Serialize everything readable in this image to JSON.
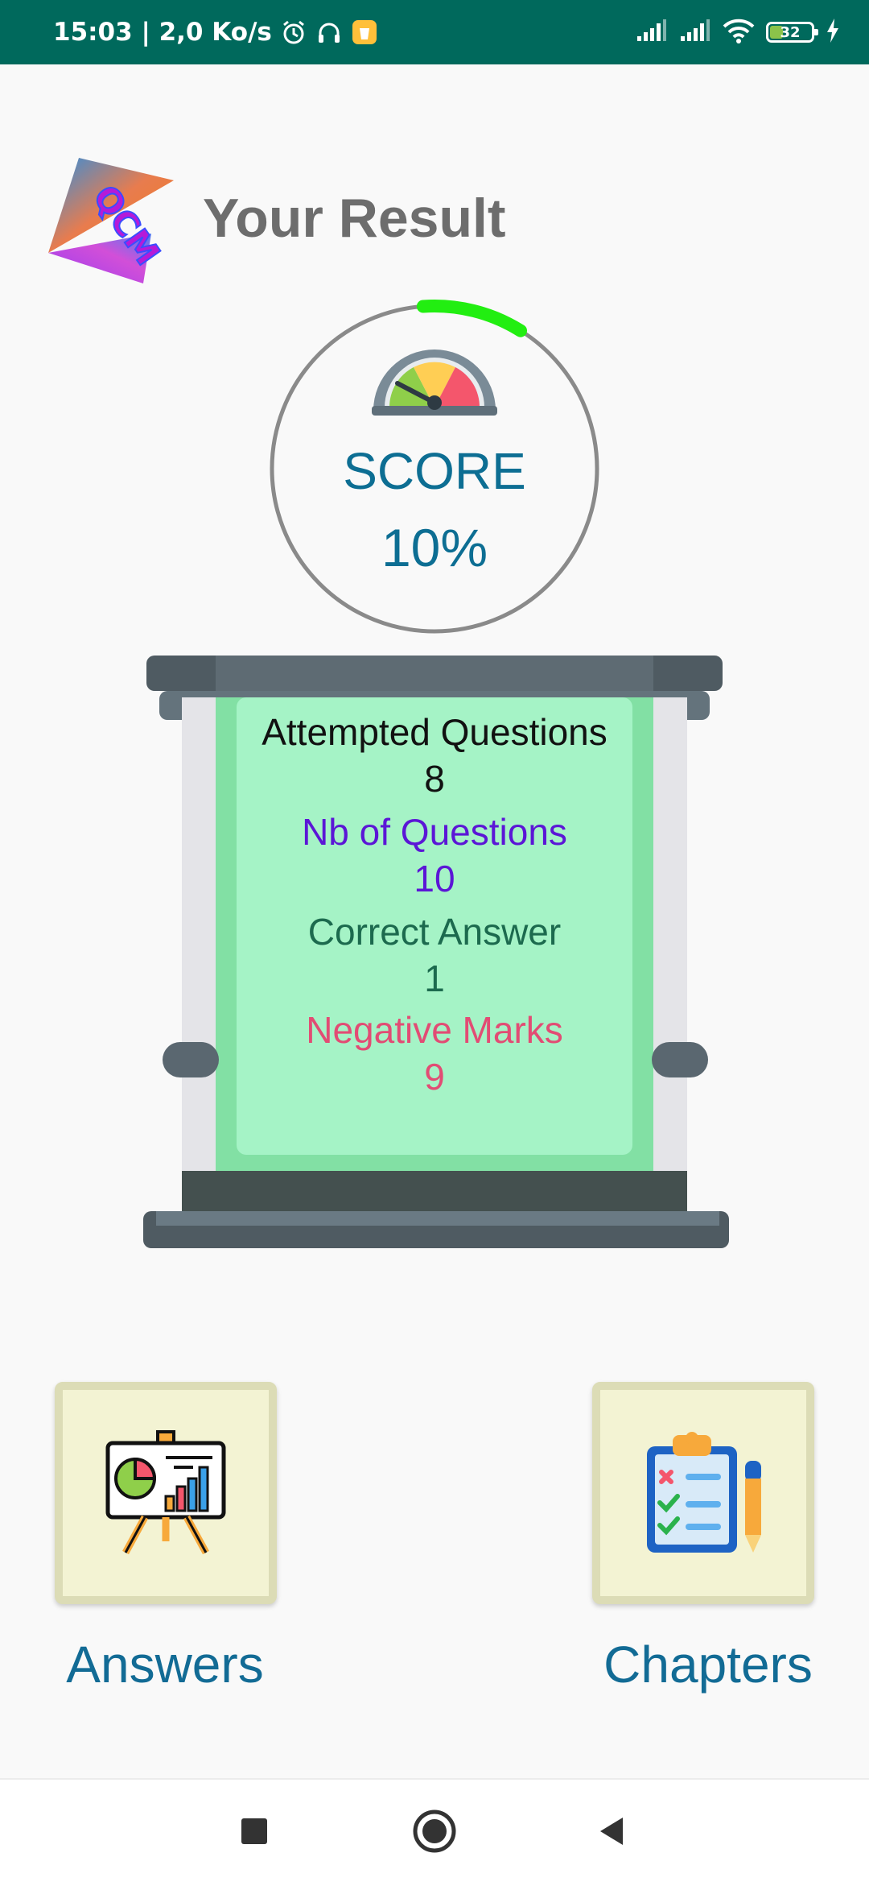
{
  "status_bar": {
    "time_speed": "15:03 | 2,0 Ko/s",
    "battery_level": "32"
  },
  "header": {
    "logo_text": "QCM",
    "title": "Your Result"
  },
  "score": {
    "label": "SCORE",
    "value": "10%",
    "percent": 10
  },
  "stats": {
    "attempted_label": "Attempted Questions",
    "attempted_value": "8",
    "nb_questions_label": "Nb of Questions",
    "nb_questions_value": "10",
    "correct_label": "Correct Answer",
    "correct_value": "1",
    "negative_label": "Negative Marks",
    "negative_value": "9"
  },
  "actions": {
    "answers_label": "Answers",
    "chapters_label": "Chapters"
  },
  "colors": {
    "status_bar": "#00695c",
    "accent_blue": "#0d6e93",
    "progress_green": "#22ee11",
    "board_green": "#a5f3c6"
  },
  "icons": {
    "gauge": "speedometer-icon",
    "answers": "presentation-chart-icon",
    "chapters": "clipboard-checklist-icon"
  }
}
